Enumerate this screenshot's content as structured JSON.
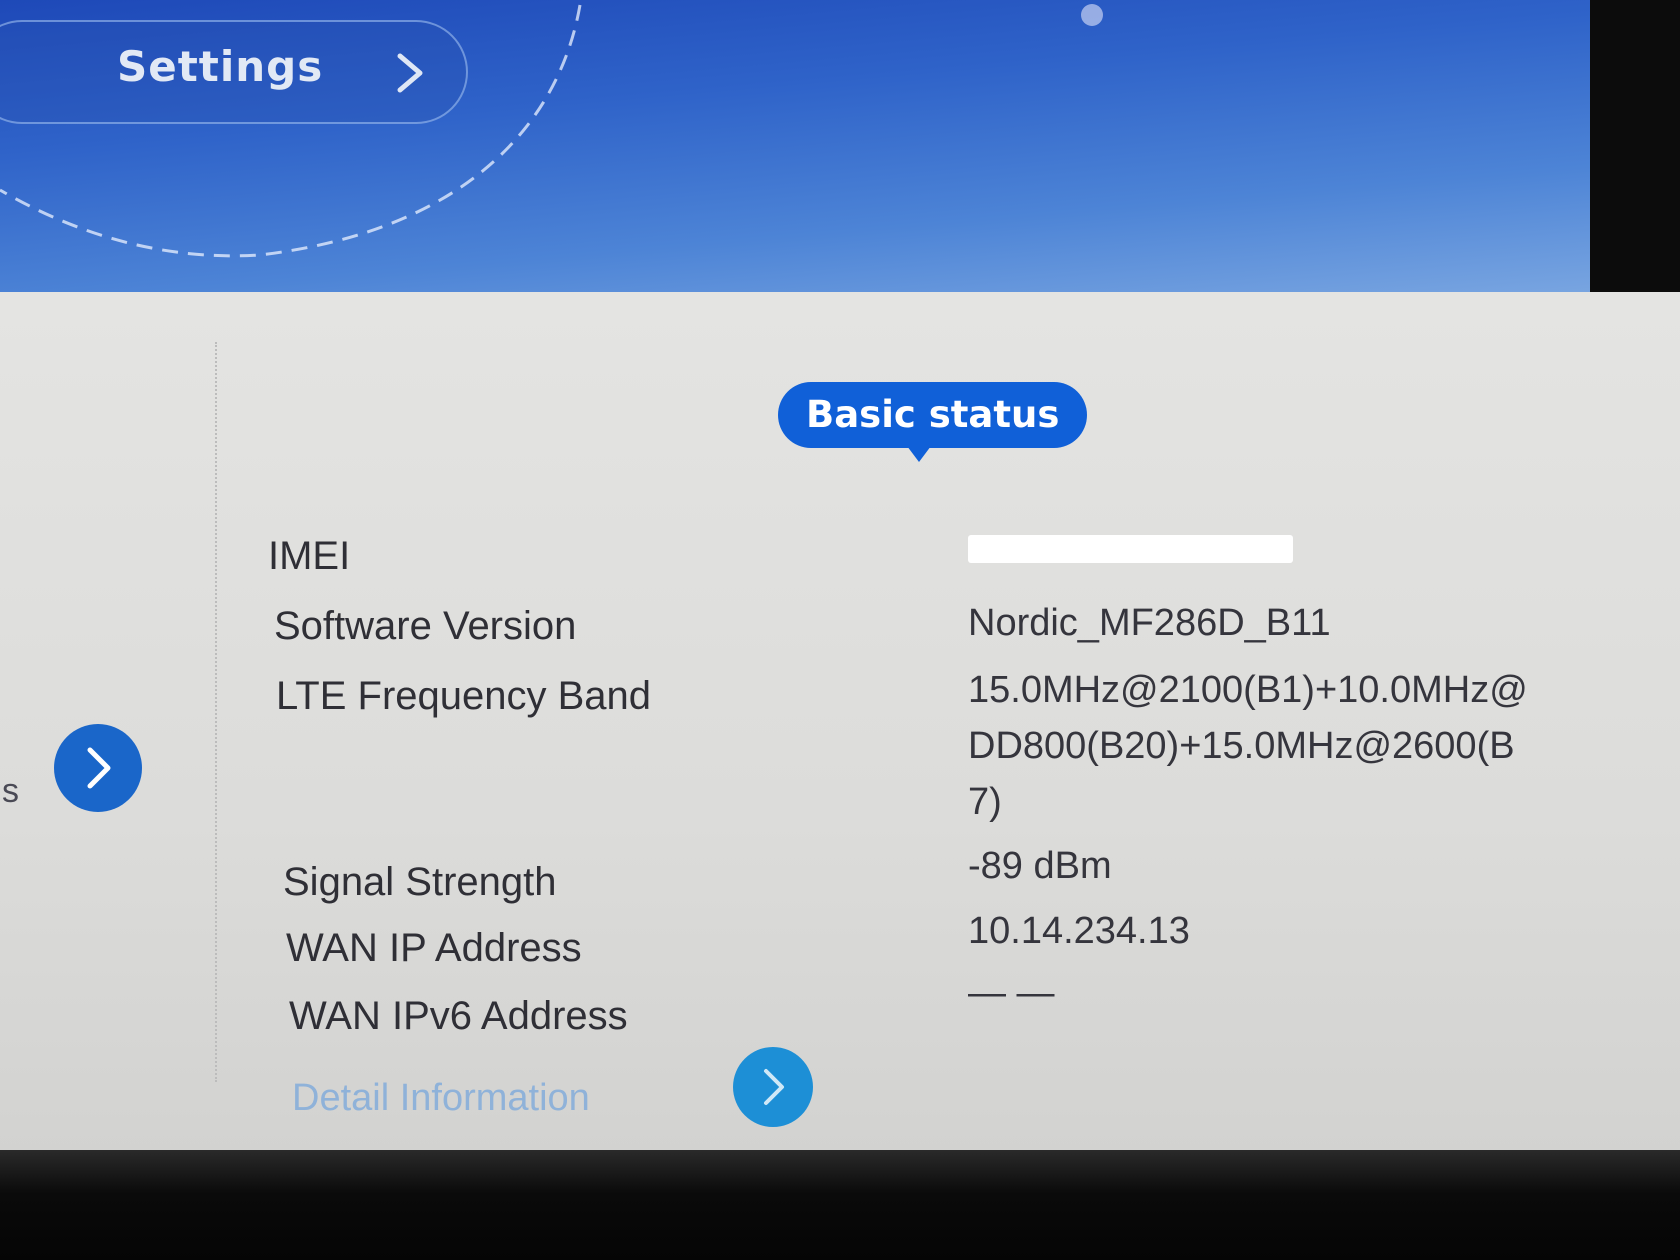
{
  "header": {
    "settings_label": "Settings",
    "icons": {
      "settings_chevron": "chevron-right-icon"
    }
  },
  "left_panel": {
    "partial_text": "s",
    "nav_icon": "chevron-right-icon"
  },
  "status_bubble": {
    "title": "Basic status"
  },
  "basic_status": {
    "rows": [
      {
        "label": "IMEI",
        "value": ""
      },
      {
        "label": "Software Version",
        "value": "Nordic_MF286D_B11"
      },
      {
        "label": "LTE Frequency Band",
        "value": "15.0MHz@2100(B1)+10.0MHz@DD800(B20)+15.0MHz@2600(B7)"
      },
      {
        "label": "Signal Strength",
        "value": "-89 dBm"
      },
      {
        "label": "WAN IP Address",
        "value": "10.14.234.13"
      },
      {
        "label": "WAN IPv6 Address",
        "value": "— —"
      }
    ],
    "detail_link": "Detail Information",
    "detail_icon": "chevron-right-icon"
  },
  "colors": {
    "banner_blue": "#2f63c9",
    "accent_blue": "#1060d8",
    "link_blue": "#8fb2d9",
    "content_bg": "#dcdcda"
  }
}
